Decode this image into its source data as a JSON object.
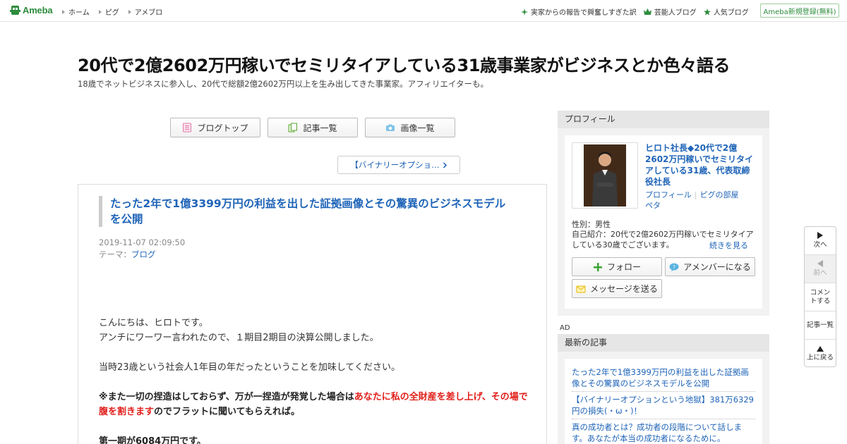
{
  "header": {
    "logo_text": "Ameba",
    "nav": [
      "ホーム",
      "ピグ",
      "アメブロ"
    ],
    "links": [
      {
        "label": "実家からの報告で興奮しすぎた訳",
        "icon": "sparkle-icon"
      },
      {
        "label": "芸能人ブログ",
        "icon": "crown-icon"
      },
      {
        "label": "人気ブログ",
        "icon": "star-icon"
      }
    ],
    "signup_label": "Ameba新規登録(無料)",
    "brand_color": "#2d8c3c"
  },
  "blog": {
    "title": "20代で2億2602万円稼いでセミリタイアしている31歳事業家がビジネスとか色々語る",
    "description": "18歳でネットビジネスに参入し、20代で総額2億2602万円以上を生み出してきた事業家。アフィリエイターも。"
  },
  "blog_nav": {
    "top": "ブログトップ",
    "entries": "記事一覧",
    "images": "画像一覧"
  },
  "prev_post": "【バイナリーオプショ…",
  "article": {
    "title": "たった2年で1億3399万円の利益を出した証拠画像とその驚異のビジネスモデルを公開",
    "date": "2019-11-07 02:09:50",
    "theme_label": "テーマ：",
    "theme": "ブログ",
    "p1_line1": "こんにちは、ヒロトです。",
    "p1_line2": "アンチにワーワー言われたので、１期目2期目の決算公開しました。",
    "p2": "当時23歳という社会人1年目の年だったということを加味してください。",
    "p3_a": "※また一切の捏造はしておらず、万が一捏造が発覚した場合は",
    "p3_red": "あなたに私の全財産を差し上げ、その場で腹を割きます",
    "p3_b": "のでフラットに聞いてもらえれば。",
    "p4_red": "第一期が6084万円です。"
  },
  "profile": {
    "heading": "プロフィール",
    "name": "ヒロト社長◆20代で2億2602万円稼いでセミリタイアしている31歳、代表取締役社長",
    "link_profile": "プロフィール",
    "link_pig": "ピグの部屋",
    "link_peta": "ペタ",
    "gender": "性別：男性",
    "intro": "自己紹介：20代で2億2602万円稼いでセミリタイアしている30歳でございます。",
    "more": "続きを見る",
    "follow": "フォロー",
    "member": "アメンバーになる",
    "message": "メッセージを送る"
  },
  "ad_label": "AD",
  "recent": {
    "heading": "最新の記事",
    "items": [
      "たった2年で1億3399万円の利益を出した証拠画像とその驚異のビジネスモデルを公開",
      "【バイナリーオプションという地獄】381万6329円の損失(・ω・)！",
      "真の成功者とは？成功者の段階について話します。あなたが本当の成功者になるために。"
    ]
  },
  "floatnav": {
    "next": "次へ",
    "prev": "前へ",
    "comment": "コメントする",
    "entries": "記事一覧",
    "top": "上に戻る"
  }
}
